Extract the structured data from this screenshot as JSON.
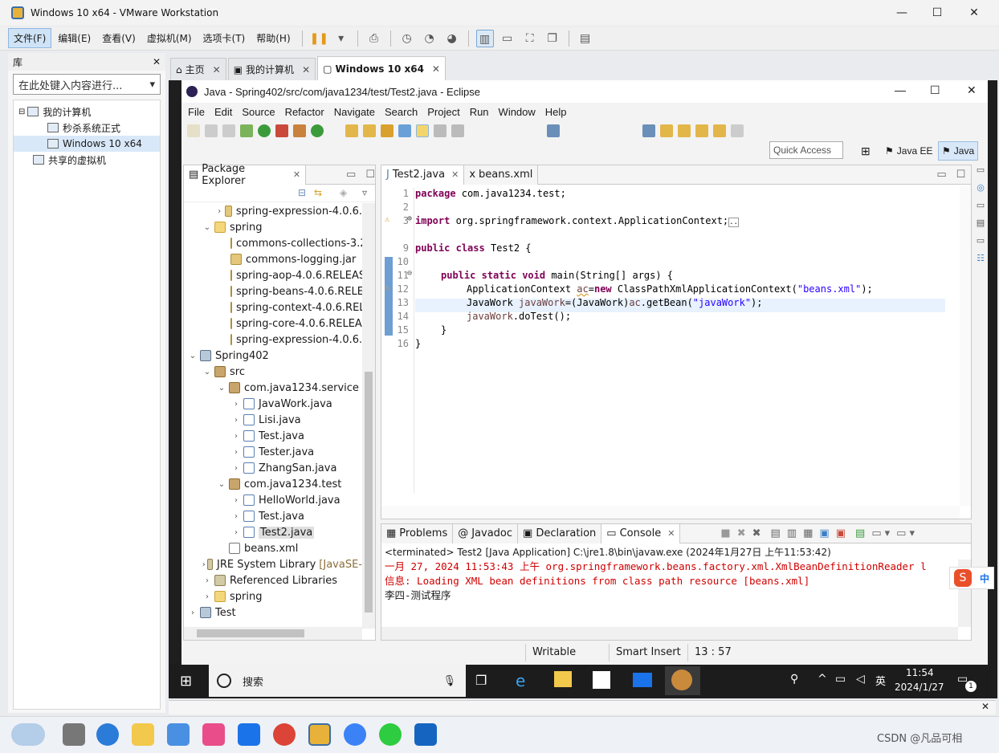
{
  "vm": {
    "title": "Windows 10 x64 - VMware Workstation",
    "window_controls": {
      "minimize": "—",
      "maximize": "☐",
      "close": "✕"
    },
    "menu": [
      "文件(F)",
      "编辑(E)",
      "查看(V)",
      "虚拟机(M)",
      "选项卡(T)",
      "帮助(H)"
    ],
    "library": {
      "title": "库",
      "close": "✕",
      "search_placeholder": "在此处键入内容进行...",
      "tree": [
        "我的计算机",
        "秒杀系统正式",
        "Windows 10 x64",
        "共享的虚拟机"
      ]
    },
    "tabs": [
      {
        "label": "主页",
        "close": "✕"
      },
      {
        "label": "我的计算机",
        "close": "✕"
      },
      {
        "label": "Windows 10 x64",
        "close": "✕"
      }
    ]
  },
  "eclipse": {
    "title": "Java - Spring402/src/com/java1234/test/Test2.java - Eclipse",
    "menu": [
      "File",
      "Edit",
      "Source",
      "Refactor",
      "Navigate",
      "Search",
      "Project",
      "Run",
      "Window",
      "Help"
    ],
    "quick_access_placeholder": "Quick Access",
    "perspectives": [
      "Java EE",
      "Java"
    ],
    "package_explorer": {
      "title": "Package Explorer",
      "items": [
        "spring-expression-4.0.6.",
        "spring",
        "commons-collections-3.2",
        "commons-logging.jar",
        "spring-aop-4.0.6.RELEAS",
        "spring-beans-4.0.6.RELE",
        "spring-context-4.0.6.REL",
        "spring-core-4.0.6.RELEAS",
        "spring-expression-4.0.6.",
        "Spring402",
        "src",
        "com.java1234.service",
        "JavaWork.java",
        "Lisi.java",
        "Test.java",
        "Tester.java",
        "ZhangSan.java",
        "com.java1234.test",
        "HelloWorld.java",
        "Test.java",
        "Test2.java",
        "beans.xml",
        "JRE System Library",
        "[JavaSE-",
        "Referenced Libraries",
        "spring",
        "Test"
      ]
    },
    "editor_tabs": [
      "Test2.java",
      "beans.xml"
    ],
    "code": {
      "line_numbers": [
        "1",
        "2",
        "3",
        "9",
        "10",
        "11",
        "12",
        "13",
        "14",
        "15",
        "16"
      ],
      "l1_kw": "package",
      "l1_rest": " com.java1234.test;",
      "l3_kw": "import",
      "l3_rest": " org.springframework.context.ApplicationContext;",
      "l9_kw1": "public",
      "l9_kw2": "class",
      "l9_rest": " Test2 {",
      "l11_kw1": "public",
      "l11_kw2": "static",
      "l11_kw3": "void",
      "l11_rest": " main(String[] args) {",
      "l12_a": "ApplicationContext ",
      "l12_var": "ac",
      "l12_eq": "=",
      "l12_kw": "new",
      "l12_b": " ClassPathXmlApplicationContext(",
      "l12_str": "\"beans.xml\"",
      "l12_c": ");",
      "l13_a": "JavaWork ",
      "l13_var": "javaWork",
      "l13_b": "=(JavaWork)",
      "l13_var2": "ac",
      "l13_c": ".getBean(",
      "l13_str": "\"javaWork\"",
      "l13_d": ");",
      "l14_var": "javaWork",
      "l14_rest": ".doTest();",
      "l15": "}",
      "l16": "}"
    },
    "console_tabs": [
      "Problems",
      "Javadoc",
      "Declaration",
      "Console"
    ],
    "console_header": "<terminated> Test2 [Java Application] C:\\jre1.8\\bin\\javaw.exe (2024年1月27日 上午11:53:42)",
    "console_lines": [
      "一月 27, 2024 11:53:43 上午 org.springframework.beans.factory.xml.XmlBeanDefinitionReader l",
      "信息: Loading XML bean definitions from class path resource [beans.xml]",
      "李四-测试程序"
    ],
    "status": {
      "writable": "Writable",
      "insert": "Smart Insert",
      "position": "13 : 57"
    }
  },
  "guest_taskbar": {
    "search_placeholder": "搜索",
    "time": "11:54",
    "date": "2024/1/27",
    "ime": "英",
    "notif_count": "1"
  },
  "ime_badge": "中",
  "watermark": "CSDN @凡品可相",
  "colors": {
    "keyword": "#7f0055",
    "string": "#2a00ff",
    "console_red": "#d00000",
    "selection": "#d9e8f9"
  }
}
